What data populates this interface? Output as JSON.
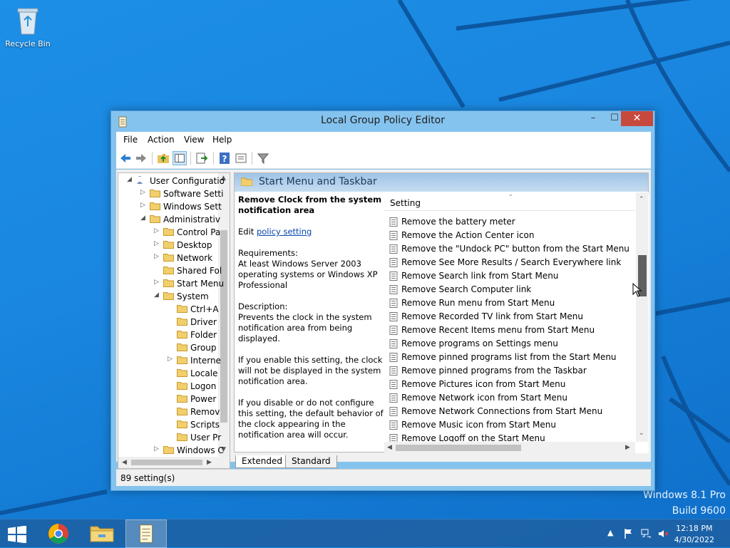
{
  "desktop": {
    "recycle_bin_label": "Recycle Bin",
    "watermark_line1": "Windows 8.1 Pro",
    "watermark_line2": "Build 9600"
  },
  "window": {
    "title": "Local Group Policy Editor",
    "menu": [
      "File",
      "Action",
      "View",
      "Help"
    ],
    "min_glyph": "–",
    "max_glyph": "☐",
    "close_glyph": "✕"
  },
  "tree": {
    "items": [
      {
        "label": "User Configuratio",
        "level": 0,
        "arrow": "◢"
      },
      {
        "label": "Software Setti",
        "level": 1,
        "arrow": "▷"
      },
      {
        "label": "Windows Sett",
        "level": 1,
        "arrow": "▷"
      },
      {
        "label": "Administrativ",
        "level": 1,
        "arrow": "◢"
      },
      {
        "label": "Control Pa",
        "level": 2,
        "arrow": "▷"
      },
      {
        "label": "Desktop",
        "level": 2,
        "arrow": "▷"
      },
      {
        "label": "Network",
        "level": 2,
        "arrow": "▷"
      },
      {
        "label": "Shared Fol",
        "level": 2,
        "arrow": ""
      },
      {
        "label": "Start Menu",
        "level": 2,
        "arrow": "▷"
      },
      {
        "label": "System",
        "level": 2,
        "arrow": "◢"
      },
      {
        "label": "Ctrl+A",
        "level": 3,
        "arrow": ""
      },
      {
        "label": "Driver",
        "level": 3,
        "arrow": ""
      },
      {
        "label": "Folder",
        "level": 3,
        "arrow": ""
      },
      {
        "label": "Group",
        "level": 3,
        "arrow": ""
      },
      {
        "label": "Interne",
        "level": 3,
        "arrow": "▷"
      },
      {
        "label": "Locale",
        "level": 3,
        "arrow": ""
      },
      {
        "label": "Logon",
        "level": 3,
        "arrow": ""
      },
      {
        "label": "Power",
        "level": 3,
        "arrow": ""
      },
      {
        "label": "Remov",
        "level": 3,
        "arrow": ""
      },
      {
        "label": "Scripts",
        "level": 3,
        "arrow": ""
      },
      {
        "label": "User Pr",
        "level": 3,
        "arrow": ""
      },
      {
        "label": "Windows C",
        "level": 2,
        "arrow": "▷"
      }
    ]
  },
  "details": {
    "header": "Start Menu and Taskbar",
    "policy_title": "Remove Clock from the system notification area",
    "edit_prefix": "Edit ",
    "edit_link": "policy setting",
    "requirements_label": "Requirements:",
    "requirements_text": "At least Windows Server 2003 operating systems or Windows XP Professional",
    "description_label": "Description:",
    "description_text": "Prevents the clock in the system notification area from being displayed.",
    "enable_text": "If you enable this setting, the clock will not be displayed in the system notification area.",
    "disable_text": "If you disable or do not configure this setting, the default behavior of the clock appearing in the notification area will occur."
  },
  "list": {
    "column_header": "Setting",
    "rows": [
      "Remove the battery meter",
      "Remove the Action Center icon",
      "Remove the \"Undock PC\" button from the Start Menu",
      "Remove See More Results / Search Everywhere link",
      "Remove Search link from Start Menu",
      "Remove Search Computer link",
      "Remove Run menu from Start Menu",
      "Remove Recorded TV link from Start Menu",
      "Remove Recent Items menu from Start Menu",
      "Remove programs on Settings menu",
      "Remove pinned programs list from the Start Menu",
      "Remove pinned programs from the Taskbar",
      "Remove Pictures icon from Start Menu",
      "Remove Network icon from Start Menu",
      "Remove Network Connections from Start Menu",
      "Remove Music icon from Start Menu",
      "Remove Logoff on the Start Menu"
    ]
  },
  "tabs": {
    "extended": "Extended",
    "standard": "Standard"
  },
  "status": {
    "text": "89 setting(s)"
  },
  "taskbar": {
    "time": "12:18 PM",
    "date": "4/30/2022",
    "tray_chevron": "▲"
  },
  "colors": {
    "desktop": "#1a86df",
    "window_frame": "#84c3ee",
    "close_button": "#c7483c",
    "header_band": "#b3d1ec",
    "link": "#0645ad"
  }
}
